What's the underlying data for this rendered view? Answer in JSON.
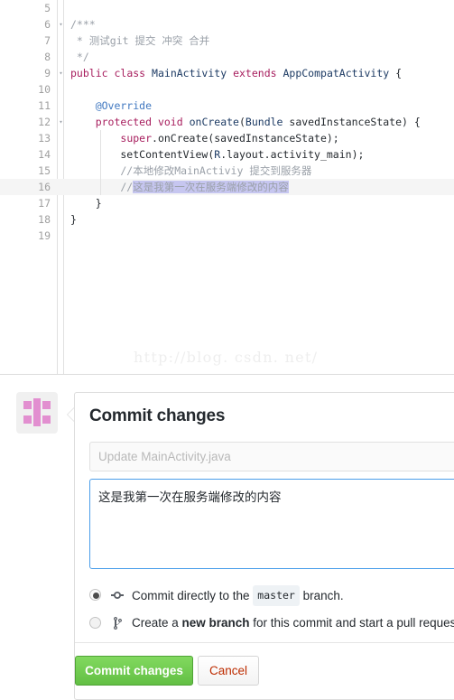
{
  "editor": {
    "watermark": "http://blog. csdn. net/",
    "lines": [
      {
        "num": "5",
        "fold": "",
        "indent": false,
        "highlight": false,
        "tokens": []
      },
      {
        "num": "6",
        "fold": "▾",
        "indent": false,
        "highlight": false,
        "tokens": [
          {
            "text": "/***",
            "cls": "cmt"
          }
        ]
      },
      {
        "num": "7",
        "fold": "",
        "indent": false,
        "highlight": false,
        "tokens": [
          {
            "text": " * 测试git 提交 冲突 合并",
            "cls": "cmt"
          }
        ]
      },
      {
        "num": "8",
        "fold": "",
        "indent": false,
        "highlight": false,
        "tokens": [
          {
            "text": " */",
            "cls": "cmt"
          }
        ]
      },
      {
        "num": "9",
        "fold": "▾",
        "indent": false,
        "highlight": false,
        "tokens": [
          {
            "text": "public",
            "cls": "kw"
          },
          {
            "text": " ",
            "cls": "pln"
          },
          {
            "text": "class",
            "cls": "kw"
          },
          {
            "text": " ",
            "cls": "pln"
          },
          {
            "text": "MainActivity",
            "cls": "typ"
          },
          {
            "text": " ",
            "cls": "pln"
          },
          {
            "text": "extends",
            "cls": "kw"
          },
          {
            "text": " ",
            "cls": "pln"
          },
          {
            "text": "AppCompatActivity",
            "cls": "typ"
          },
          {
            "text": " {",
            "cls": "pln"
          }
        ]
      },
      {
        "num": "10",
        "fold": "",
        "indent": false,
        "highlight": false,
        "tokens": []
      },
      {
        "num": "11",
        "fold": "",
        "indent": false,
        "highlight": false,
        "tokens": [
          {
            "text": "    @Override",
            "cls": "ann"
          }
        ]
      },
      {
        "num": "12",
        "fold": "▾",
        "indent": false,
        "highlight": false,
        "tokens": [
          {
            "text": "    ",
            "cls": "pln"
          },
          {
            "text": "protected",
            "cls": "kw"
          },
          {
            "text": " ",
            "cls": "pln"
          },
          {
            "text": "void",
            "cls": "kw"
          },
          {
            "text": " ",
            "cls": "pln"
          },
          {
            "text": "onCreate",
            "cls": "typ"
          },
          {
            "text": "(",
            "cls": "pln"
          },
          {
            "text": "Bundle",
            "cls": "typ"
          },
          {
            "text": " savedInstanceState) {",
            "cls": "pln"
          }
        ]
      },
      {
        "num": "13",
        "fold": "",
        "indent": true,
        "highlight": false,
        "tokens": [
          {
            "text": "        ",
            "cls": "pln"
          },
          {
            "text": "super",
            "cls": "kw"
          },
          {
            "text": ".onCreate(savedInstanceState);",
            "cls": "pln"
          }
        ]
      },
      {
        "num": "14",
        "fold": "",
        "indent": true,
        "highlight": false,
        "tokens": [
          {
            "text": "        setContentView(",
            "cls": "pln"
          },
          {
            "text": "R",
            "cls": "typ"
          },
          {
            "text": ".layout.activity_main);",
            "cls": "pln"
          }
        ]
      },
      {
        "num": "15",
        "fold": "",
        "indent": true,
        "highlight": false,
        "tokens": [
          {
            "text": "        //本地修改MainActiviy 提交到服务器",
            "cls": "cmt"
          }
        ]
      },
      {
        "num": "16",
        "fold": "",
        "indent": true,
        "highlight": true,
        "tokens": [
          {
            "text": "        //",
            "cls": "cmt"
          },
          {
            "text": "这是我第一次在服务端修改的内容",
            "cls": "cmt sel"
          }
        ]
      },
      {
        "num": "17",
        "fold": "",
        "indent": false,
        "highlight": false,
        "tokens": [
          {
            "text": "    }",
            "cls": "pln"
          }
        ]
      },
      {
        "num": "18",
        "fold": "",
        "indent": false,
        "highlight": false,
        "tokens": [
          {
            "text": "}",
            "cls": "pln"
          }
        ]
      },
      {
        "num": "19",
        "fold": "",
        "indent": false,
        "highlight": false,
        "tokens": []
      }
    ]
  },
  "commit_form": {
    "title": "Commit changes",
    "avatar_icon": "identicon-avatar",
    "summary_placeholder": "Update MainActivity.java",
    "summary_value": "",
    "description_value": "这是我第一次在服务端修改的内容",
    "options": [
      {
        "selected": true,
        "icon": "git-commit-icon",
        "text_before": "Commit directly to the ",
        "chip": "master",
        "text_after": " branch."
      },
      {
        "selected": false,
        "icon": "git-branch-icon",
        "text_before": "Create a ",
        "strong": "new branch",
        "text_after": " for this commit and start a pull request."
      }
    ],
    "submit_label": "Commit changes",
    "cancel_label": "Cancel"
  },
  "colors": {
    "keyword": "#a71d5d",
    "type": "#1c3a63",
    "annotation": "#4078c0",
    "comment": "#9aa0a8",
    "selection": "#c6c6f0",
    "submit_green": "#73ce52",
    "cancel_red": "#bd2c00",
    "focus_blue": "#4a9eea",
    "avatar_pink": "#e28fd0"
  }
}
